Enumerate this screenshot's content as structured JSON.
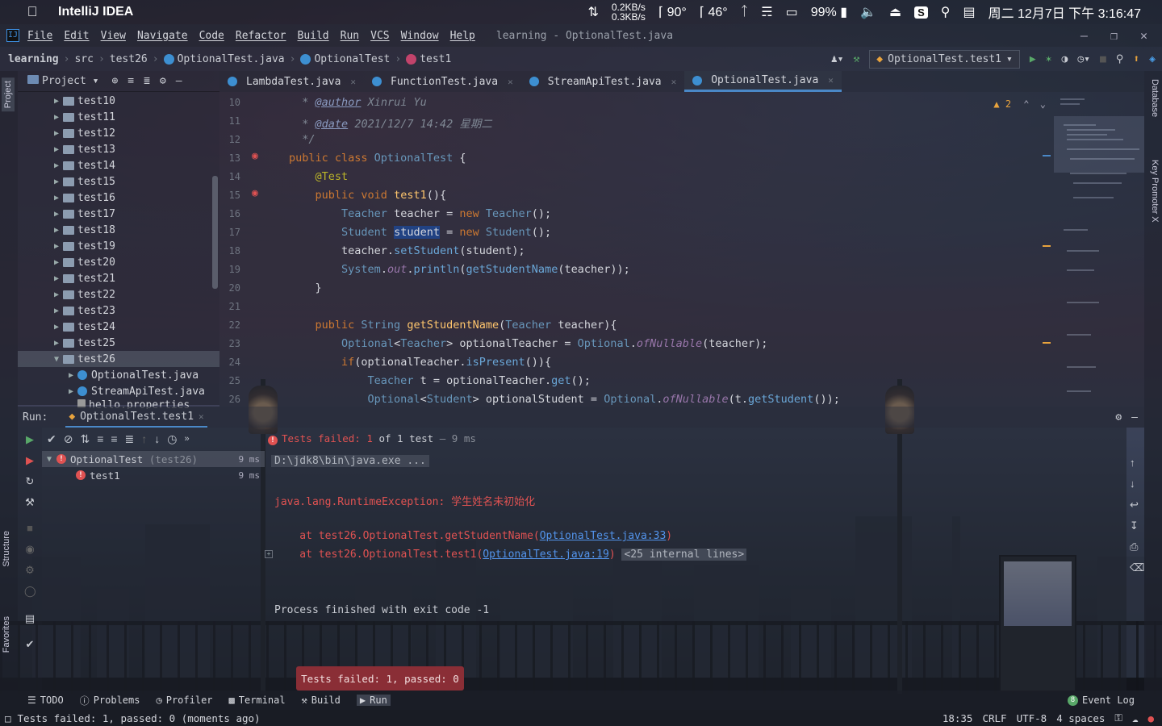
{
  "macos": {
    "app_name": "IntelliJ IDEA",
    "net_up": "0.2KB/s",
    "net_down": "0.3KB/s",
    "temp1": "90°",
    "temp2": "46°",
    "battery": "99%",
    "clock": "周二 12月7日 下午 3:16:47"
  },
  "menu": {
    "items": [
      "File",
      "Edit",
      "View",
      "Navigate",
      "Code",
      "Refactor",
      "Build",
      "Run",
      "VCS",
      "Window",
      "Help"
    ],
    "window_title": "learning - OptionalTest.java"
  },
  "breadcrumb": [
    "learning",
    "src",
    "test26",
    "OptionalTest.java",
    "OptionalTest",
    "test1"
  ],
  "run_config": "OptionalTest.test1",
  "project": {
    "title": "Project",
    "folders": [
      "test10",
      "test11",
      "test12",
      "test13",
      "test14",
      "test15",
      "test16",
      "test17",
      "test18",
      "test19",
      "test20",
      "test21",
      "test22",
      "test23",
      "test24",
      "test25",
      "test26"
    ],
    "children": [
      "OptionalTest.java",
      "StreamApiTest.java",
      "hello.properties"
    ]
  },
  "tabs": [
    "LambdaTest.java",
    "FunctionTest.java",
    "StreamApiTest.java",
    "OptionalTest.java"
  ],
  "editor": {
    "line_numbers": [
      "10",
      "11",
      "12",
      "13",
      "14",
      "15",
      "16",
      "17",
      "18",
      "19",
      "20",
      "21",
      "22",
      "23",
      "24",
      "25",
      "26"
    ],
    "warnings": "2",
    "author_tag": "@author",
    "author": "Xinrui Yu",
    "date_tag": "@date",
    "date": "2021/12/7 14:42 星期二"
  },
  "run": {
    "label": "Run:",
    "tab": "OptionalTest.test1",
    "status_failed": "Tests failed:",
    "status_count": "1",
    "status_of": "of",
    "status_total": "1 test",
    "status_time": "9 ms",
    "tree": [
      {
        "name": "OptionalTest",
        "pkg": "(test26)",
        "time": "9 ms"
      },
      {
        "name": "test1",
        "time": "9 ms"
      }
    ],
    "console": {
      "java_cmd": "D:\\jdk8\\bin\\java.exe ...",
      "exception": "java.lang.RuntimeException: 学生姓名未初始化",
      "at1_prefix": "    at test26.OptionalTest.getStudentName(",
      "at1_link": "OptionalTest.java:33",
      "at1_suffix": ")",
      "at2_prefix": "    at test26.OptionalTest.test1(",
      "at2_link": "OptionalTest.java:19",
      "at2_suffix": ")",
      "internal": "<25 internal lines>",
      "finished": "Process finished with exit code -1"
    }
  },
  "balloon": "Tests failed: 1, passed: 0",
  "toolwindows": [
    "TODO",
    "Problems",
    "Profiler",
    "Terminal",
    "Build",
    "Run"
  ],
  "event_log": "Event Log",
  "event_log_count": "8",
  "status": {
    "message": "Tests failed: 1, passed: 0 (moments ago)",
    "position": "18:35",
    "line_sep": "CRLF",
    "encoding": "UTF-8",
    "indent": "4 spaces"
  },
  "side_tabs": {
    "left": [
      "Project",
      "Structure",
      "Favorites"
    ],
    "right": [
      "Database",
      "Key Promoter X"
    ]
  }
}
